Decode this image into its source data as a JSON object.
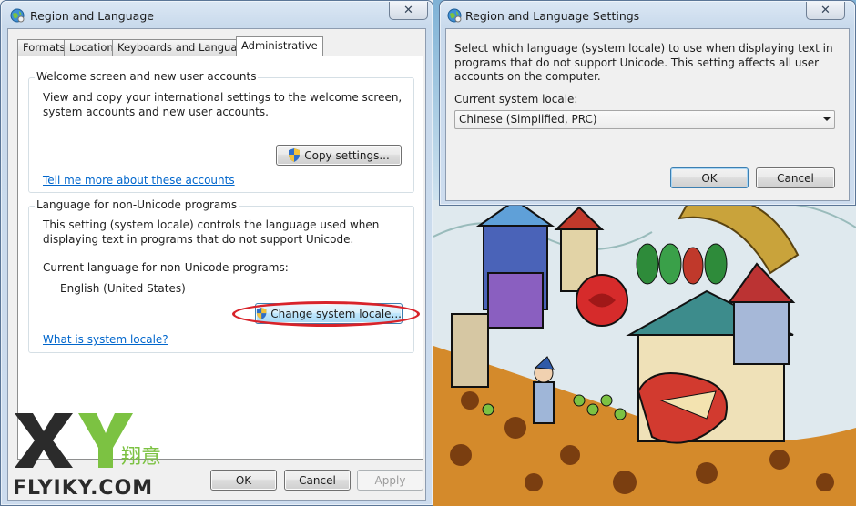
{
  "main_window": {
    "title": "Region and Language",
    "close_label": "✕",
    "tabs": [
      {
        "label": "Formats"
      },
      {
        "label": "Location"
      },
      {
        "label": "Keyboards and Languages"
      },
      {
        "label": "Administrative"
      }
    ],
    "active_tab": "Administrative",
    "welcome_group": {
      "title": "Welcome screen and new user accounts",
      "description": "View and copy your international settings to the welcome screen, system accounts and new user accounts.",
      "copy_button": "Copy settings...",
      "link": "Tell me more about these accounts"
    },
    "nonunicode_group": {
      "title": "Language for non-Unicode programs",
      "description": "This setting (system locale) controls the language used when displaying text in programs that do not support Unicode.",
      "current_label": "Current language for non-Unicode programs:",
      "current_value": "English (United States)",
      "change_button": "Change system locale...",
      "link": "What is system locale?"
    },
    "footer": {
      "ok": "OK",
      "cancel": "Cancel",
      "apply": "Apply"
    }
  },
  "dialog": {
    "title": "Region and Language Settings",
    "close_label": "✕",
    "description": "Select which language (system locale) to use when displaying text in programs that do not support Unicode. This setting affects all user accounts on the computer.",
    "locale_label": "Current system locale:",
    "locale_value": "Chinese (Simplified, PRC)",
    "ok": "OK",
    "cancel": "Cancel"
  },
  "watermark": {
    "letters": "X Y",
    "cn_text": "翔意",
    "site": "FLYIKY.COM"
  },
  "colors": {
    "link": "#0066cc",
    "highlight_ring": "#d8232a",
    "watermark_x": "#2b2b2b",
    "watermark_y": "#7cc242"
  }
}
